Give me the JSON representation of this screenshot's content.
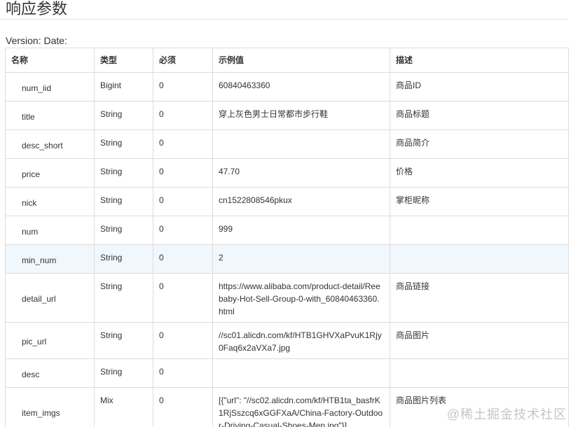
{
  "heading": "响应参数",
  "version_line": "Version: Date:",
  "columns": [
    "名称",
    "类型",
    "必须",
    "示例值",
    "描述"
  ],
  "rows": [
    {
      "name": "num_iid",
      "type": "Bigint",
      "required": "0",
      "example": "60840463360",
      "desc": "商品ID"
    },
    {
      "name": "title",
      "type": "String",
      "required": "0",
      "example": "穿上灰色男士日常都市步行鞋",
      "desc": "商品标题"
    },
    {
      "name": "desc_short",
      "type": "String",
      "required": "0",
      "example": "",
      "desc": "商品简介"
    },
    {
      "name": "price",
      "type": "String",
      "required": "0",
      "example": "47.70",
      "desc": "价格"
    },
    {
      "name": "nick",
      "type": "String",
      "required": "0",
      "example": "cn1522808546pkux",
      "desc": "掌柜昵称"
    },
    {
      "name": "num",
      "type": "String",
      "required": "0",
      "example": "999",
      "desc": ""
    },
    {
      "name": "min_num",
      "type": "String",
      "required": "0",
      "example": "2",
      "desc": ""
    },
    {
      "name": "detail_url",
      "type": "String",
      "required": "0",
      "example": "https://www.alibaba.com/product-detail/Reebaby-Hot-Sell-Group-0-with_60840463360.html",
      "desc": "商品链接"
    },
    {
      "name": "pic_url",
      "type": "String",
      "required": "0",
      "example": "//sc01.alicdn.com/kf/HTB1GHVXaPvuK1Rjy0Faq6x2aVXa7.jpg",
      "desc": "商品图片"
    },
    {
      "name": "desc",
      "type": "String",
      "required": "0",
      "example": "",
      "desc": ""
    },
    {
      "name": "item_imgs",
      "type": "Mix",
      "required": "0",
      "example": "[{\"url\": \"//sc02.alicdn.com/kf/HTB1ta_basfrK1RjSszcq6xGGFXaA/China-Factory-Outdoor-Driving-Casual-Shoes-Men.jpg\"}]",
      "desc": "商品图片列表"
    }
  ],
  "watermark": "@稀土掘金技术社区"
}
